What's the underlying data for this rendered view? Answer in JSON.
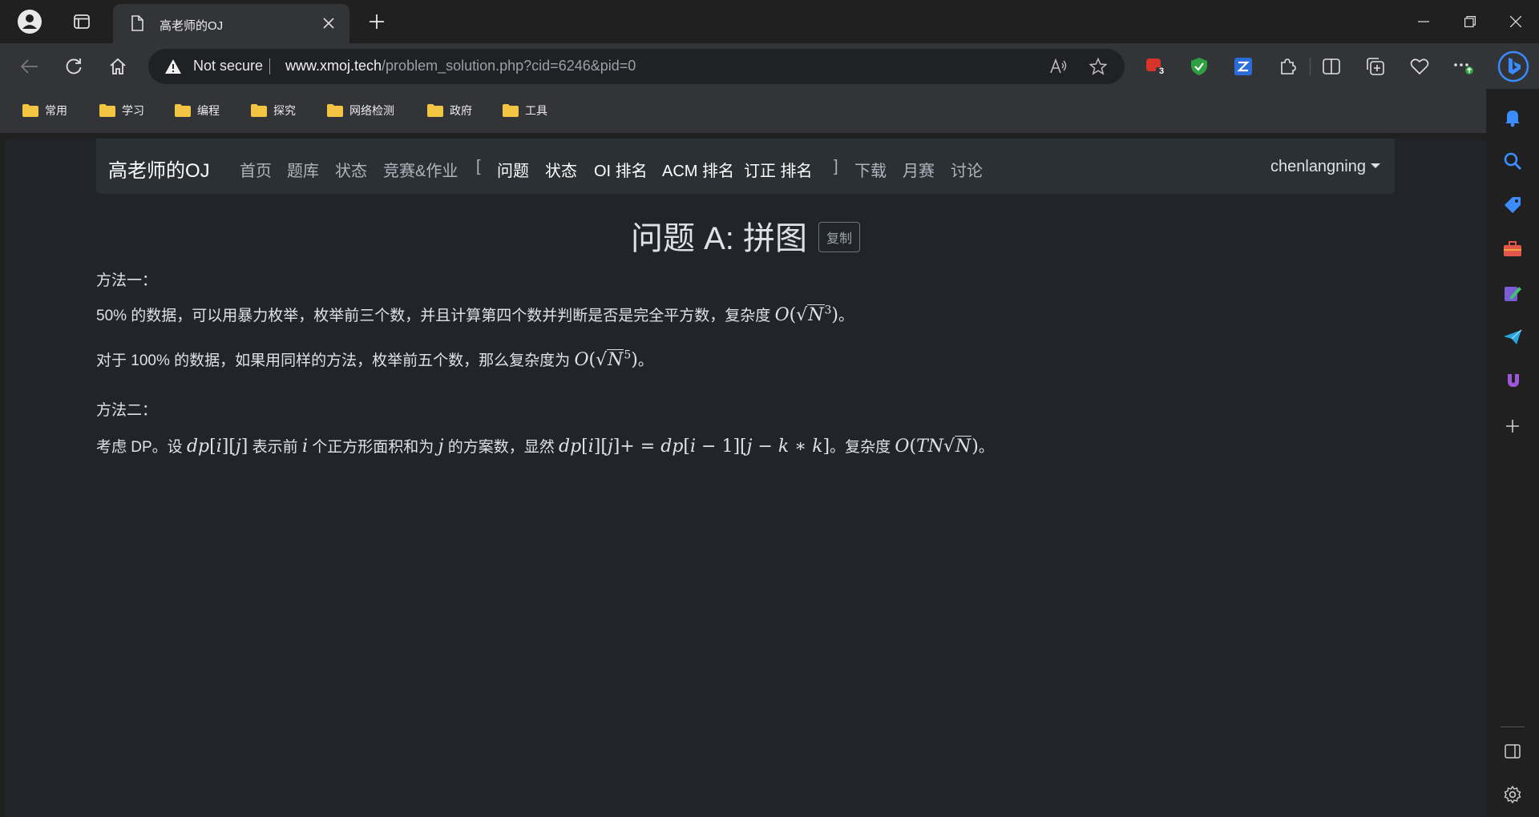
{
  "browser": {
    "tab_title": "高老师的OJ",
    "address": {
      "security_label": "Not secure",
      "host": "www.xmoj.tech",
      "path": "/problem_solution.php?cid=6246&pid=0"
    },
    "extension_badge": "3",
    "favorites": [
      "常用",
      "学习",
      "编程",
      "探究",
      "网络检测",
      "政府",
      "工具"
    ]
  },
  "site": {
    "brand": "高老师的OJ",
    "nav": [
      "首页",
      "题库",
      "状态",
      "竞赛&作业",
      "[",
      "问题",
      "状态",
      "OI 排名",
      "ACM 排名",
      "订正 排名",
      "]",
      "下载",
      "月赛",
      "讨论"
    ],
    "user": "chenlangning"
  },
  "problem": {
    "title": "问题 A: 拼图",
    "copy_label": "复制",
    "p1": "方法一：",
    "p2_text": "50% 的数据，可以用暴力枚举，枚举前三个数，并且计算第四个数并判断是否是完全平方数，复杂度",
    "p2_exp": "3",
    "p3_text": "对于 100% 的数据，如果用同样的方法，枚举前五个数，那么复杂度为",
    "p3_exp": "5",
    "p4": "方法二：",
    "p5_a": "考虑 DP。设",
    "p5_b": "表示前",
    "p5_c": "个正方形面积和为",
    "p5_d": "的方案数，显然",
    "p5_e": "。复杂度",
    "period": "。"
  }
}
